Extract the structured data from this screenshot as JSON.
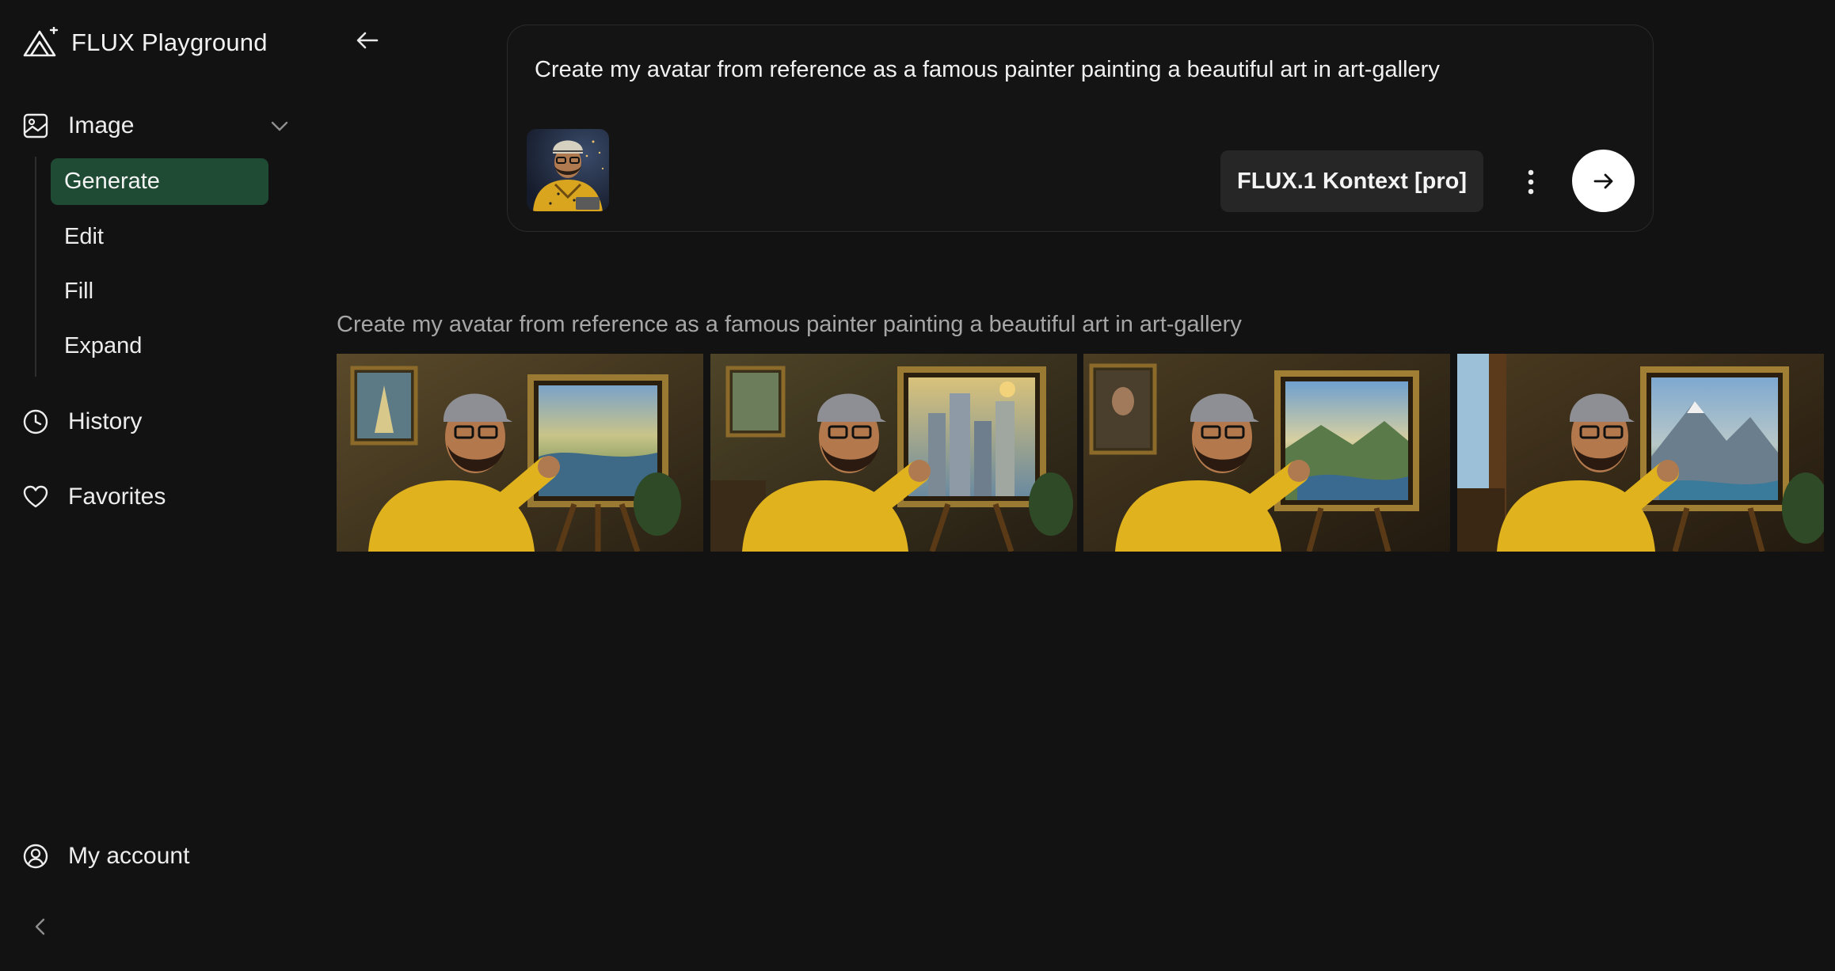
{
  "app": {
    "name": "FLUX Playground"
  },
  "sidebar": {
    "group": {
      "label": "Image",
      "icon": "image-icon",
      "expanded": true,
      "items": [
        {
          "label": "Generate",
          "active": true
        },
        {
          "label": "Edit",
          "active": false
        },
        {
          "label": "Fill",
          "active": false
        },
        {
          "label": "Expand",
          "active": false
        }
      ]
    },
    "history_label": "History",
    "favorites_label": "Favorites",
    "account_label": "My account"
  },
  "prompt_card": {
    "prompt": "Create my avatar from reference as a famous painter painting a beautiful art in art-gallery",
    "model_label": "FLUX.1 Kontext [pro]"
  },
  "results": {
    "prompt": "Create my avatar from reference as a famous painter painting a beautiful art in art-gallery",
    "image_count": 4
  },
  "colors": {
    "background": "#121212",
    "active_nav": "#1f4a33",
    "submit_button": "#ffffff",
    "hoodie_yellow": "#e8b81e"
  }
}
